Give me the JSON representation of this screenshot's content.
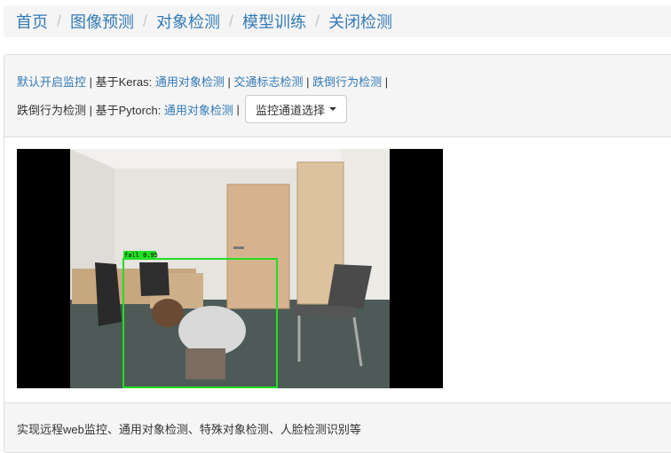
{
  "breadcrumb": {
    "items": [
      "首页",
      "图像预测",
      "对象检测",
      "模型训练",
      "关闭检测"
    ],
    "separator": "/"
  },
  "controls": {
    "default_monitor": "默认开启监控",
    "keras_prefix": " | 基于Keras: ",
    "keras_general": "通用对象检测",
    "keras_traffic": "交通标志检测",
    "keras_fall": "跌倒行为检测",
    "pipe": " | ",
    "fall_detect_text": "跌倒行为检测",
    "pytorch_prefix": " | 基于Pytorch: ",
    "pytorch_general": "通用对象检测",
    "channel_select": "监控通道选择"
  },
  "video": {
    "detection_label": "fall 0.95",
    "box_color": "#22dd22"
  },
  "footer": {
    "text": "实现远程web监控、通用对象检测、特殊对象检测、人脸检测识别等"
  }
}
